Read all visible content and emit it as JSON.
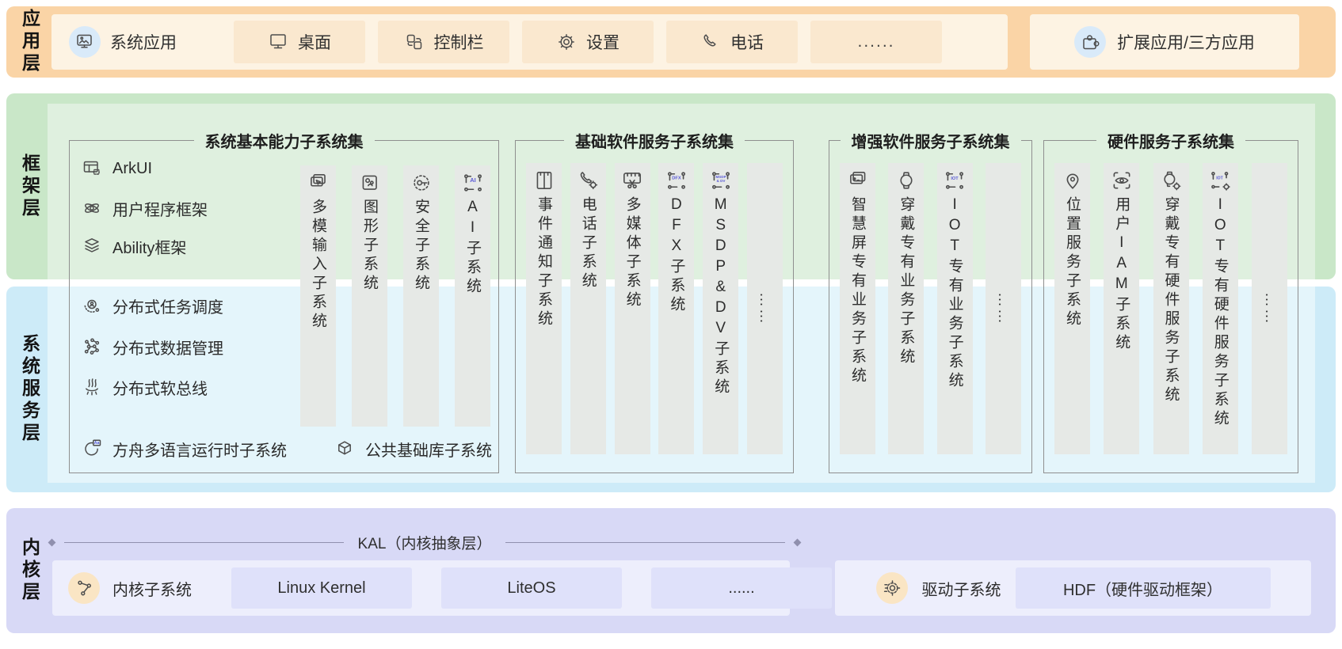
{
  "colors": {
    "app_band": "#FAD4A6",
    "app_panel": "#FDF3E3",
    "app_box": "#FAE8CF",
    "framework_band": "#C9E7C8",
    "framework_panel": "#DFF0DF",
    "system_service_band": "#CDEBF8",
    "system_service_panel": "#E4F5FB",
    "kernel_band": "#D8D9F6",
    "kernel_panel": "#EDEEFC",
    "kernel_box": "#DFE1FA",
    "pillar": "#E6E9E6",
    "section_border": "#8f8f8f",
    "icon_stroke": "#4d4d4d",
    "icon_accent_blue": "#5b5bd6",
    "icon_circle_blue": "#D9EAF9",
    "icon_circle_peach": "#FAE5C4"
  },
  "layers": {
    "app": {
      "label": "应用层",
      "items": [
        {
          "icon": "system-app-icon",
          "label": "系统应用"
        },
        {
          "icon": "desktop-icon",
          "label": "桌面"
        },
        {
          "icon": "control-bar-icon",
          "label": "控制栏"
        },
        {
          "icon": "gear-icon",
          "label": "设置"
        },
        {
          "icon": "phone-icon",
          "label": "电话"
        },
        {
          "icon": "ellipsis",
          "label": "......"
        }
      ],
      "extension": {
        "icon": "puzzle-icon",
        "label": "扩展应用/三方应用"
      }
    },
    "framework": {
      "label": "框架层"
    },
    "system_service": {
      "label": "系统服务层"
    },
    "kernel": {
      "label": "内核层",
      "kal_title": "KAL（内核抽象层）",
      "kernel_subsystem": {
        "icon": "branch-icon",
        "label": "内核子系统"
      },
      "kernel_options": [
        "Linux Kernel",
        "LiteOS",
        "......"
      ],
      "driver_subsystem": {
        "icon": "driver-gear-icon",
        "label": "驱动子系统"
      },
      "driver_options": [
        "HDF（硬件驱动框架）"
      ]
    }
  },
  "sections": [
    {
      "title": "系统基本能力子系统集",
      "framework_items": [
        {
          "icon": "arkui-icon",
          "label": "ArkUI"
        },
        {
          "icon": "user-program-framework-icon",
          "label": "用户程序框架"
        },
        {
          "icon": "ability-icon",
          "label": "Ability框架"
        }
      ],
      "service_items": [
        {
          "icon": "distributed-task-icon",
          "label": "分布式任务调度"
        },
        {
          "icon": "distributed-data-icon",
          "label": "分布式数据管理"
        },
        {
          "icon": "softbus-icon",
          "label": "分布式软总线"
        }
      ],
      "bottom_items": [
        {
          "icon": "ark-runtime-icon",
          "label": "方舟多语言运行时子系统"
        },
        {
          "icon": "cube-icon",
          "label": "公共基础库子系统"
        }
      ],
      "pillars": [
        {
          "icon": "multimodal-input-icon",
          "label": "多模输入子系统"
        },
        {
          "icon": "graphics-icon",
          "label": "图形子系统"
        },
        {
          "icon": "security-icon",
          "label": "安全子系统"
        },
        {
          "icon": "ai-icon",
          "label": "AI子系统"
        }
      ]
    },
    {
      "title": "基础软件服务子系统集",
      "pillars": [
        {
          "icon": "event-notification-icon",
          "label": "事件通知子系统"
        },
        {
          "icon": "telephony-icon",
          "label": "电话子系统"
        },
        {
          "icon": "multimedia-icon",
          "label": "多媒体子系统"
        },
        {
          "icon": "dfx-icon",
          "label": "DFX子系统"
        },
        {
          "icon": "msdp-dv-icon",
          "label": "MSDP&DV子系统"
        }
      ],
      "ellipsis": "……"
    },
    {
      "title": "增强软件服务子系统集",
      "pillars": [
        {
          "icon": "smart-screen-icon",
          "label": "智慧屏专有业务子系统"
        },
        {
          "icon": "wearable-icon",
          "label": "穿戴专有业务子系统"
        },
        {
          "icon": "iot-icon",
          "label": "IOT专有业务子系统"
        }
      ],
      "ellipsis": "……"
    },
    {
      "title": "硬件服务子系统集",
      "pillars": [
        {
          "icon": "location-icon",
          "label": "位置服务子系统"
        },
        {
          "icon": "user-iam-icon",
          "label": "用户IAM子系统"
        },
        {
          "icon": "wearable-hardware-icon",
          "label": "穿戴专有硬件服务子系统"
        },
        {
          "icon": "iot-hardware-icon",
          "label": "IOT专有硬件服务子系统"
        }
      ],
      "ellipsis": "……"
    }
  ]
}
